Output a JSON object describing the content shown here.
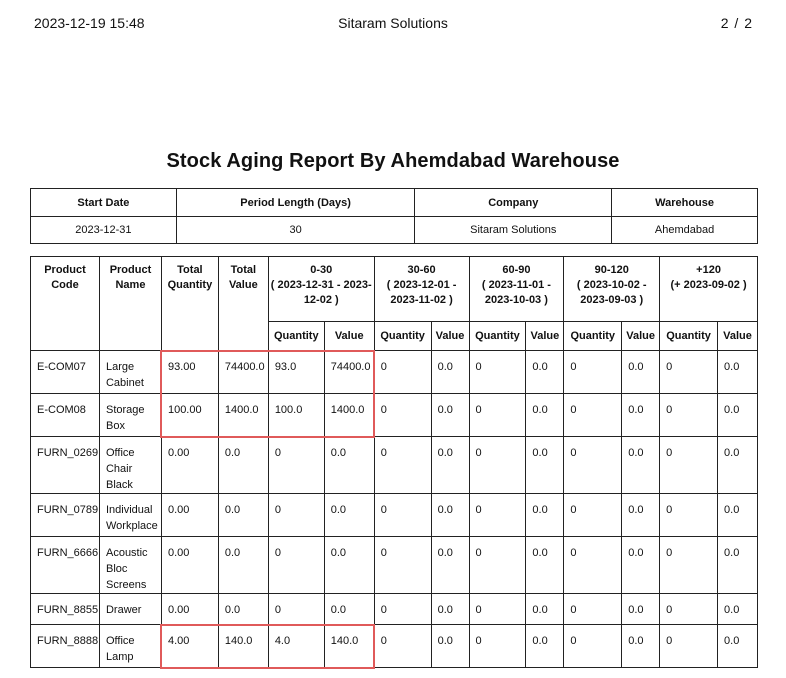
{
  "header": {
    "datetime": "2023-12-19 15:48",
    "company": "Sitaram Solutions",
    "page_indicator": "2  /  2"
  },
  "report": {
    "title": "Stock Aging Report By Ahemdabad Warehouse"
  },
  "info": {
    "headers": [
      "Start Date",
      "Period Length (Days)",
      "Company",
      "Warehouse"
    ],
    "values": [
      "2023-12-31",
      "30",
      "Sitaram Solutions",
      "Ahemdabad"
    ]
  },
  "columns": {
    "product_code": "Product Code",
    "product_name": "Product Name",
    "total_quantity": "Total Quantity",
    "total_value": "Total Value",
    "periods": [
      {
        "range": "0-30",
        "dates": "( 2023-12-31 - 2023-12-02 )"
      },
      {
        "range": "30-60",
        "dates": "( 2023-12-01 - 2023-11-02 )"
      },
      {
        "range": "60-90",
        "dates": "( 2023-11-01 - 2023-10-03 )"
      },
      {
        "range": "90-120",
        "dates": "( 2023-10-02 - 2023-09-03 )"
      },
      {
        "range": "+120",
        "dates": "(+ 2023-09-02 )"
      }
    ],
    "sub_quantity": "Quantity",
    "sub_value": "Value"
  },
  "rows": [
    {
      "code": "E-COM07",
      "name": "Large Cabinet",
      "total_qty": "93.00",
      "total_val": "74400.0",
      "p": [
        [
          "93.0",
          "74400.0"
        ],
        [
          "0",
          "0.0"
        ],
        [
          "0",
          "0.0"
        ],
        [
          "0",
          "0.0"
        ],
        [
          "0",
          "0.0"
        ]
      ]
    },
    {
      "code": "E-COM08",
      "name": "Storage Box",
      "total_qty": "100.00",
      "total_val": "1400.0",
      "p": [
        [
          "100.0",
          "1400.0"
        ],
        [
          "0",
          "0.0"
        ],
        [
          "0",
          "0.0"
        ],
        [
          "0",
          "0.0"
        ],
        [
          "0",
          "0.0"
        ]
      ]
    },
    {
      "code": "FURN_0269",
      "name": "Office Chair Black",
      "total_qty": "0.00",
      "total_val": "0.0",
      "p": [
        [
          "0",
          "0.0"
        ],
        [
          "0",
          "0.0"
        ],
        [
          "0",
          "0.0"
        ],
        [
          "0",
          "0.0"
        ],
        [
          "0",
          "0.0"
        ]
      ]
    },
    {
      "code": "FURN_0789",
      "name": "Individual Workplace",
      "total_qty": "0.00",
      "total_val": "0.0",
      "p": [
        [
          "0",
          "0.0"
        ],
        [
          "0",
          "0.0"
        ],
        [
          "0",
          "0.0"
        ],
        [
          "0",
          "0.0"
        ],
        [
          "0",
          "0.0"
        ]
      ]
    },
    {
      "code": "FURN_6666",
      "name": "Acoustic Bloc Screens",
      "total_qty": "0.00",
      "total_val": "0.0",
      "p": [
        [
          "0",
          "0.0"
        ],
        [
          "0",
          "0.0"
        ],
        [
          "0",
          "0.0"
        ],
        [
          "0",
          "0.0"
        ],
        [
          "0",
          "0.0"
        ]
      ]
    },
    {
      "code": "FURN_8855",
      "name": "Drawer",
      "total_qty": "0.00",
      "total_val": "0.0",
      "p": [
        [
          "0",
          "0.0"
        ],
        [
          "0",
          "0.0"
        ],
        [
          "0",
          "0.0"
        ],
        [
          "0",
          "0.0"
        ],
        [
          "0",
          "0.0"
        ]
      ]
    },
    {
      "code": "FURN_8888",
      "name": "Office Lamp",
      "total_qty": "4.00",
      "total_val": "140.0",
      "p": [
        [
          "4.0",
          "140.0"
        ],
        [
          "0",
          "0.0"
        ],
        [
          "0",
          "0.0"
        ],
        [
          "0",
          "0.0"
        ],
        [
          "0",
          "0.0"
        ]
      ]
    }
  ],
  "highlight_color": "#e05a5a"
}
